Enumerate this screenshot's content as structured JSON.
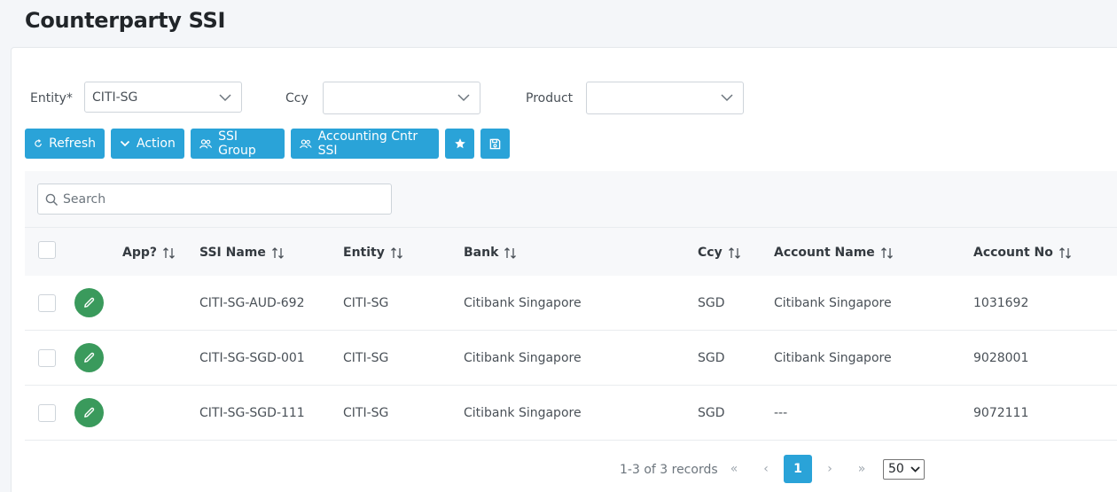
{
  "page": {
    "title": "Counterparty SSI"
  },
  "filters": {
    "entity_label": "Entity*",
    "entity_value": "CITI-SG",
    "ccy_label": "Ccy",
    "ccy_value": "",
    "product_label": "Product",
    "product_value": ""
  },
  "toolbar": {
    "refresh": "Refresh",
    "action": "Action",
    "ssi_group": "SSI Group",
    "accounting_cntr_ssi": "Accounting Cntr SSI"
  },
  "search": {
    "placeholder": "Search",
    "value": ""
  },
  "table": {
    "columns": [
      "App?",
      "SSI Name",
      "Entity",
      "Bank",
      "Ccy",
      "Account Name",
      "Account No"
    ],
    "rows": [
      {
        "app": "",
        "ssi_name": "CITI-SG-AUD-692",
        "entity": "CITI-SG",
        "bank": "Citibank Singapore",
        "ccy": "SGD",
        "account_name": "Citibank Singapore",
        "account_no": "1031692"
      },
      {
        "app": "",
        "ssi_name": "CITI-SG-SGD-001",
        "entity": "CITI-SG",
        "bank": "Citibank Singapore",
        "ccy": "SGD",
        "account_name": "Citibank Singapore",
        "account_no": "9028001"
      },
      {
        "app": "",
        "ssi_name": "CITI-SG-SGD-111",
        "entity": "CITI-SG",
        "bank": "Citibank Singapore",
        "ccy": "SGD",
        "account_name": "---",
        "account_no": "9072111"
      }
    ]
  },
  "pagination": {
    "summary": "1-3 of 3 records",
    "current_page": "1",
    "rows_per_page": "50",
    "first": "«",
    "prev": "‹",
    "next": "›",
    "last": "»"
  },
  "colors": {
    "primary": "#2aa3d8",
    "edit": "#3a9a5c"
  }
}
